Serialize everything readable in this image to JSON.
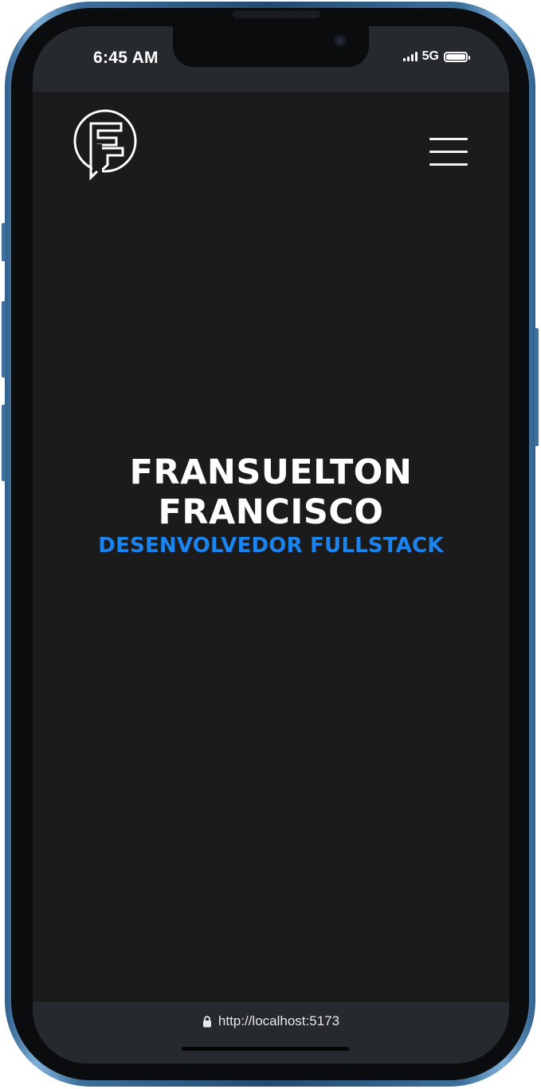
{
  "status_bar": {
    "time": "6:45 AM",
    "network": "5G",
    "icons": [
      "signal-icon",
      "battery-icon"
    ]
  },
  "header": {
    "logo_icon": "ff-monogram-logo-icon",
    "menu_icon": "hamburger-menu-icon"
  },
  "hero": {
    "name_line1": "FRANSUELTON",
    "name_line2": "FRANCISCO",
    "role": "DESENVOLVEDOR FULLSTACK"
  },
  "browser": {
    "url": "http://localhost:5173",
    "lock_icon": "lock-icon"
  },
  "colors": {
    "background": "#1b1b1c",
    "bars": "#26292d",
    "accent": "#1a84f0",
    "text": "#ffffff",
    "phone_frame": "#2f5f8c"
  }
}
